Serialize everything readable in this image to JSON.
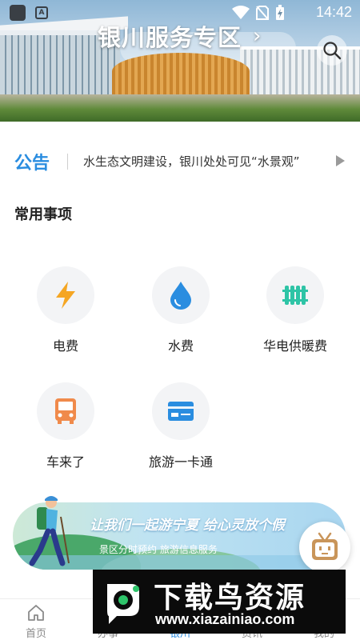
{
  "status_bar": {
    "time": "14:42",
    "app_badge": "A"
  },
  "header": {
    "title": "银川服务专区",
    "chevron": "›",
    "search_icon": "search-icon"
  },
  "notice": {
    "title": "公告",
    "text": "水生态文明建设，银川处处可见“水景观”"
  },
  "section": {
    "title": "常用事项"
  },
  "services": [
    {
      "label": "电费",
      "icon": "lightning-icon",
      "color": "#f5a623"
    },
    {
      "label": "水费",
      "icon": "water-drop-icon",
      "color": "#2a8de0"
    },
    {
      "label": "华电供暖费",
      "icon": "radiator-icon",
      "color": "#2ec4a6"
    },
    {
      "label": "车来了",
      "icon": "bus-icon",
      "color": "#f08a4b"
    },
    {
      "label": "旅游一卡通",
      "icon": "card-icon",
      "color": "#2a8de0"
    }
  ],
  "banner": {
    "slogan": "让我们一起游宁夏 给心灵放个假",
    "subtitle": "景区分时预约 旅游信息服务"
  },
  "tabs": [
    {
      "label": "首页",
      "icon": "home-icon"
    },
    {
      "label": "办事",
      "icon": "tasks-icon"
    },
    {
      "label": "银川",
      "icon": "city-icon"
    },
    {
      "label": "资讯",
      "icon": "news-icon"
    },
    {
      "label": "我的",
      "icon": "user-icon"
    }
  ],
  "watermark": {
    "text": "下载鸟资源",
    "url": "www.xiazainiao.com"
  },
  "colors": {
    "accent": "#2a8de0",
    "text": "#222222",
    "muted": "#8a8a8a"
  }
}
